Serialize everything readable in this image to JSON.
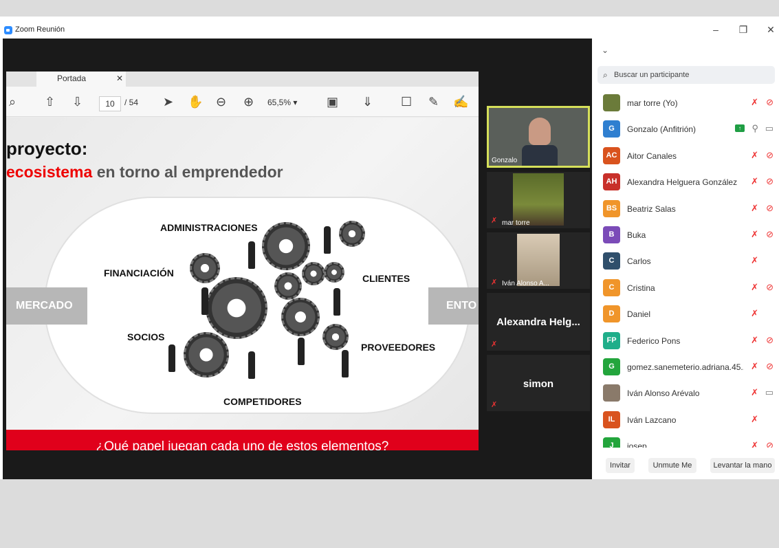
{
  "window": {
    "title": "Zoom Reunión",
    "minimize_icon": "minimize-icon",
    "restore_icon": "restore-icon",
    "close_icon": "close-icon"
  },
  "viewer": {
    "tab_label": "Portada",
    "page_current": "10",
    "page_total": "/ 54",
    "zoom": "65,5%"
  },
  "slide": {
    "title_line1": "proyecto:",
    "title_red": "ecosistema",
    "title_rest": " en torno al emprendedor",
    "left_box": "MERCADO",
    "right_box": "ENTO",
    "labels": {
      "administraciones": "ADMINISTRACIONES",
      "financiacion": "FINANCIACIÓN",
      "clientes": "CLIENTES",
      "socios": "SOCIOS",
      "proveedores": "PROVEEDORES",
      "competidores": "COMPETIDORES"
    },
    "question": "¿Qué papel juegan cada uno de estos elementos?"
  },
  "thumbnails": [
    {
      "name": "Gonzalo"
    },
    {
      "name": "mar torre"
    },
    {
      "name": "Iván Alonso A..."
    },
    {
      "name": "Alexandra  Helg..."
    },
    {
      "name": "simon"
    }
  ],
  "panel": {
    "search_placeholder": "Buscar un participante",
    "participants": [
      {
        "name": "mar torre (Yo)",
        "initials": "",
        "color": "#6b7b3a",
        "mic": "off",
        "cam": "off"
      },
      {
        "name": "Gonzalo (Anfitrión)",
        "initials": "G",
        "color": "#2f7fd0",
        "mic": "on",
        "cam": "on"
      },
      {
        "name": "Aitor Canales",
        "initials": "AC",
        "color": "#d9531e",
        "mic": "off",
        "cam": "off"
      },
      {
        "name": "Alexandra Helguera González",
        "initials": "AH",
        "color": "#c8302a",
        "mic": "off",
        "cam": "off"
      },
      {
        "name": "Beatriz Salas",
        "initials": "BS",
        "color": "#f0952a",
        "mic": "off",
        "cam": "off"
      },
      {
        "name": "Buka",
        "initials": "B",
        "color": "#7b4bb8",
        "mic": "off",
        "cam": "off"
      },
      {
        "name": "Carlos",
        "initials": "C",
        "color": "#2f4f6b",
        "mic": "off",
        "cam": ""
      },
      {
        "name": "Cristina",
        "initials": "C",
        "color": "#f0952a",
        "mic": "off",
        "cam": "off"
      },
      {
        "name": "Daniel",
        "initials": "D",
        "color": "#f0952a",
        "mic": "off",
        "cam": ""
      },
      {
        "name": "Federico Pons",
        "initials": "FP",
        "color": "#1fae8a",
        "mic": "off",
        "cam": "off"
      },
      {
        "name": "gomez.sanemeterio.adriana.45...",
        "initials": "G",
        "color": "#23a53c",
        "mic": "off",
        "cam": "off"
      },
      {
        "name": "Iván Alonso Arévalo",
        "initials": "",
        "color": "#8a7a6a",
        "mic": "off",
        "cam": "on"
      },
      {
        "name": "Iván Lazcano",
        "initials": "IL",
        "color": "#d9531e",
        "mic": "off",
        "cam": ""
      },
      {
        "name": "josep",
        "initials": "J",
        "color": "#23a53c",
        "mic": "off",
        "cam": "off"
      }
    ],
    "buttons": {
      "invite": "Invitar",
      "unmute": "Unmute Me",
      "raise_hand": "Levantar la mano"
    }
  }
}
